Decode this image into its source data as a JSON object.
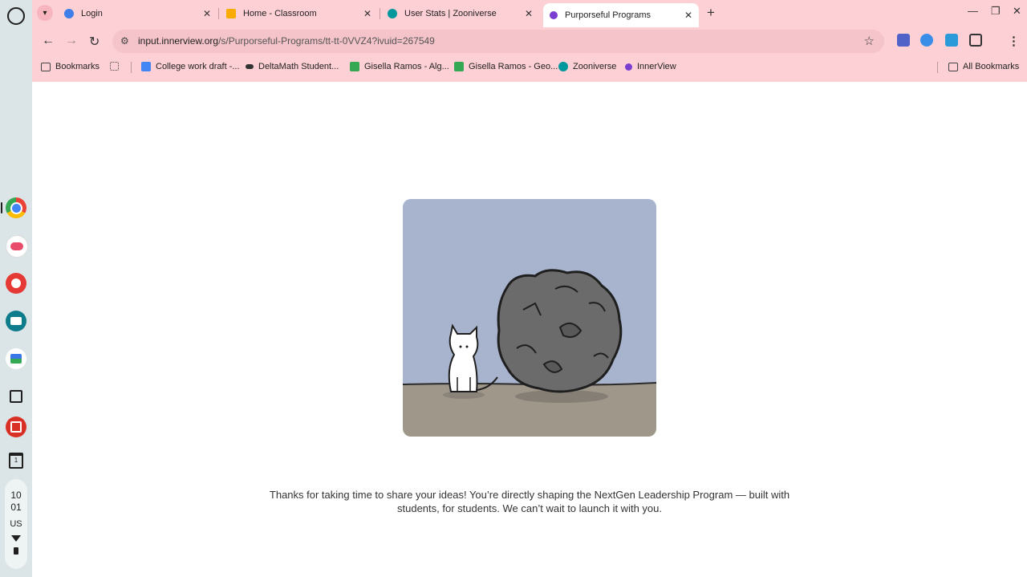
{
  "shelf": {
    "clock_hour": "10",
    "clock_minute": "01",
    "locale": "US"
  },
  "tabs": [
    {
      "title": "Login",
      "active": false
    },
    {
      "title": "Home - Classroom",
      "active": false
    },
    {
      "title": "User Stats | Zooniverse",
      "active": false
    },
    {
      "title": "Purporseful Programs",
      "active": true
    }
  ],
  "toolbar": {
    "url_host": "input.innerview.org",
    "url_path": "/s/Purporseful-Programs/tt-tt-0VVZ4?ivuid=267549"
  },
  "bookmarks": {
    "bookmarks_label": "Bookmarks",
    "items": [
      "College work draft -...",
      "DeltaMath Student...",
      "Gisella Ramos - Alg...",
      "Gisella Ramos - Geo...",
      "Zooniverse",
      "InnerView"
    ],
    "all_bookmarks": "All Bookmarks"
  },
  "page": {
    "thanks_line1": "Thanks for taking  time to share your ideas! You’re directly shaping the NextGen Leadership Program — built with",
    "thanks_line2": "students, for students. We can’t wait to launch it with you."
  },
  "colors": {
    "chrome_bg": "#fdd0d5",
    "sky": "#a8b4cd",
    "ground": "#a0978b",
    "rock": "#6b6b6b"
  }
}
